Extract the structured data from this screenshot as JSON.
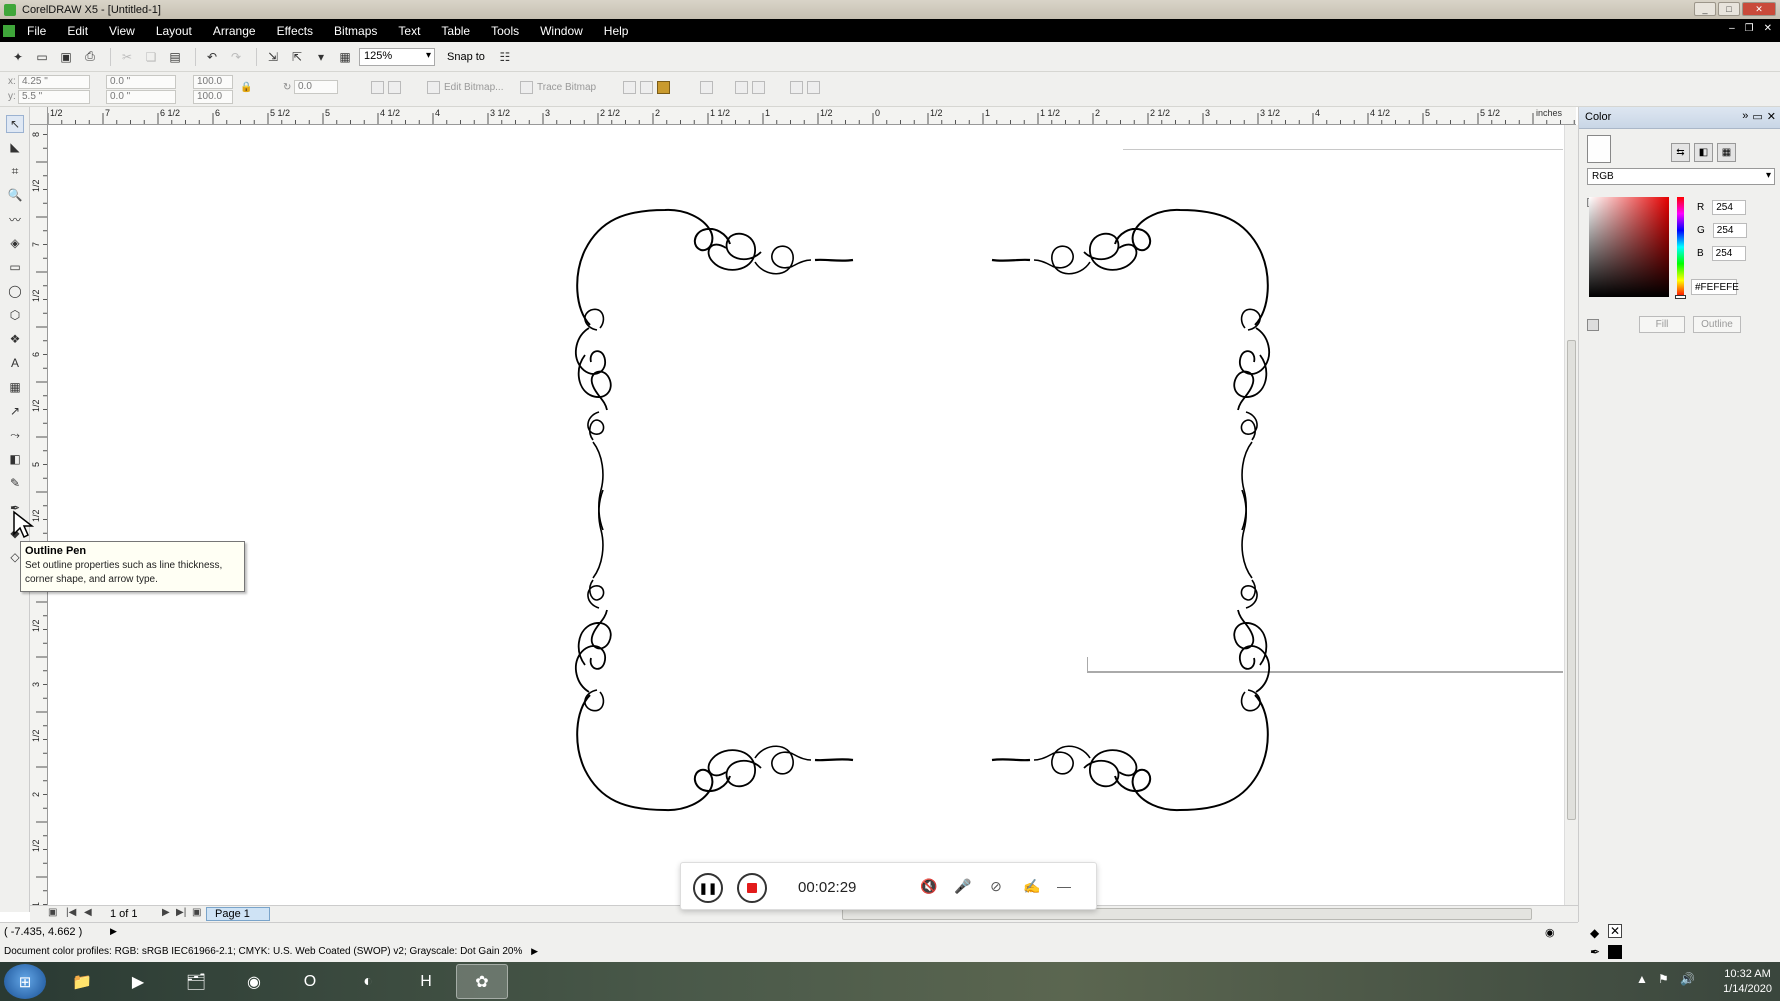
{
  "window": {
    "title": "CorelDRAW X5 - [Untitled-1]",
    "controls": [
      "_",
      "□",
      "✕"
    ]
  },
  "menu": [
    "File",
    "Edit",
    "View",
    "Layout",
    "Arrange",
    "Effects",
    "Bitmaps",
    "Text",
    "Table",
    "Tools",
    "Window",
    "Help"
  ],
  "toolbar": {
    "zoom": "125%",
    "snap": "Snap to"
  },
  "propbar": {
    "x": "4.25 \"",
    "y": "5.5 \"",
    "w": "0.0 \"",
    "h": "0.0 \"",
    "sx": "100.0",
    "sy": "100.0",
    "angle": "0.0",
    "edit_bitmap": "Edit Bitmap...",
    "trace_bitmap": "Trace Bitmap"
  },
  "ruler": {
    "unit": "inches",
    "h_labels": [
      "1/2",
      "7",
      "6 1/2",
      "6",
      "5 1/2",
      "5",
      "4 1/2",
      "4",
      "3 1/2",
      "3",
      "2 1/2",
      "2",
      "1 1/2",
      "1",
      "1/2",
      "0",
      "1/2",
      "1",
      "1 1/2",
      "2",
      "2 1/2",
      "3",
      "3 1/2",
      "4",
      "4 1/2",
      "5",
      "5 1/2"
    ],
    "v_labels": [
      "8",
      "1/2",
      "7",
      "1/2",
      "6",
      "1/2",
      "5",
      "1/2",
      "4",
      "1/2",
      "3",
      "1/2",
      "2",
      "1/2",
      "1",
      "1/2"
    ]
  },
  "tooltip": {
    "title": "Outline Pen",
    "body": "Set outline properties such as line thickness, corner shape, and arrow type."
  },
  "pagebar": {
    "count": "1 of 1",
    "tab": "Page 1"
  },
  "status": {
    "coords": "( -7.435, 4.662 )",
    "profiles": "Document color profiles: RGB: sRGB IEC61966-2.1; CMYK: U.S. Web Coated (SWOP) v2; Grayscale: Dot Gain 20%"
  },
  "docker": {
    "title": "Color",
    "model": "RGB",
    "r": "254",
    "g": "254",
    "b": "254",
    "r_label": "R",
    "g_label": "G",
    "b_label": "B",
    "hex": "#FEFEFE",
    "fill": "Fill",
    "outline": "Outline",
    "current_color": "#fefefe"
  },
  "recorder": {
    "time": "00:02:29"
  },
  "taskbar": {
    "time": "10:32 AM",
    "date": "1/14/2020"
  }
}
